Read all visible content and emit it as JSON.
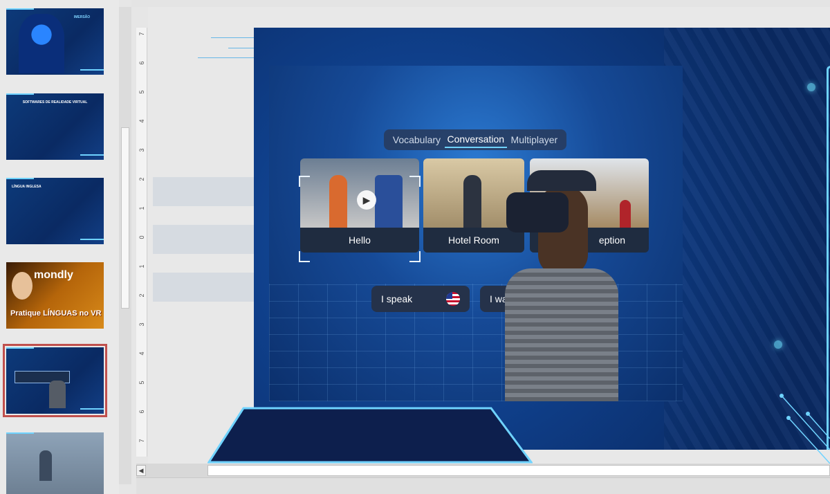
{
  "thumbnails": [
    {
      "title": "IMERSÃO",
      "body": ""
    },
    {
      "title": "SOFTWARES DE REALIDADE VIRTUAL",
      "body": ""
    },
    {
      "title": "LÍNGUA INGLESA",
      "body": ""
    },
    {
      "brand": "mondly",
      "title": "Pratique LÍNGUAS no VR"
    },
    {
      "selected": true
    },
    {}
  ],
  "ruler": {
    "labels": [
      "7",
      "6",
      "5",
      "4",
      "3",
      "2",
      "1",
      "0",
      "1",
      "2",
      "3",
      "4",
      "5",
      "6",
      "7"
    ]
  },
  "slide": {
    "tabs": [
      "Vocabulary",
      "Conversation",
      "Multiplayer"
    ],
    "active_tab": "Conversation",
    "cards": [
      "Hello",
      "Hotel Room",
      "eption"
    ],
    "pills": [
      "I speak",
      "I wa"
    ]
  },
  "scrollbar": {
    "left_arrow": "◀"
  },
  "colors": {
    "accent": "#6fd3ff",
    "selection": "#c0504d",
    "slide_bg": "#0f3f8a"
  }
}
